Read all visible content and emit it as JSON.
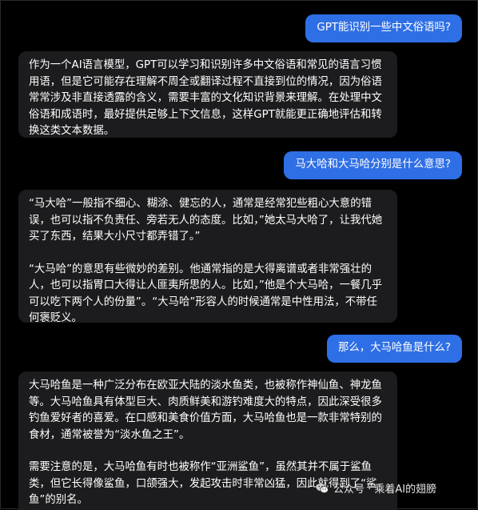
{
  "conversation": {
    "messages": [
      {
        "role": "user",
        "text": "GPT能识别一些中文俗语吗?"
      },
      {
        "role": "assistant",
        "paragraphs": [
          "作为一个AI语言模型，GPT可以学习和识别许多中文俗语和常见的语言习惯用语，但是它可能存在理解不周全或翻译过程不直接到位的情况，因为俗语常常涉及非直接透露的含义，需要丰富的文化知识背景来理解。在处理中文俗语和成语时，最好提供足够上下文信息，这样GPT就能更正确地评估和转换这类文本数据。"
        ]
      },
      {
        "role": "user",
        "text": "马大哈和大马哈分别是什么意思?"
      },
      {
        "role": "assistant",
        "paragraphs": [
          "“马大哈”一般指不细心、糊涂、健忘的人，通常是经常犯些粗心大意的错误，也可以指不负责任、旁若无人的态度。比如，”她太马大哈了，让我代她买了东西，结果大小尺寸都弄错了。”",
          "“大马哈”的意思有些微妙的差别。他通常指的是大得离谱或者非常强壮的人，也可以指胃口大得让人匪夷所思的人。比如，”他是个大马哈，一餐几乎可以吃下两个人的份量”。“大马哈”形容人的时候通常是中性用法，不带任何褒贬义。"
        ]
      },
      {
        "role": "user",
        "text": "那么，大马哈鱼是什么?"
      },
      {
        "role": "assistant",
        "paragraphs": [
          "大马哈鱼是一种广泛分布在欧亚大陆的淡水鱼类，也被称作神仙鱼、神龙鱼等。大马哈鱼具有体型巨大、肉质鲜美和游钓难度大的特点，因此深受很多钓鱼爱好者的喜爱。在口感和美食价值方面，大马哈鱼也是一款非常特别的食材，通常被誉为“淡水鱼之王”。",
          "需要注意的是，大马哈鱼有时也被称作“亚洲鲨鱼”，虽然其并不属于鲨鱼类，但它长得像鲨鱼，口颌强大，发起攻击时非常凶猛，因此就得到了“鲨鱼”的别名。"
        ]
      }
    ]
  },
  "watermark": {
    "icon": "wechat-icon",
    "text": "公众号 · 乘着AI的翅膀"
  },
  "colors": {
    "background": "#000000",
    "user_bubble": "#2f6fe5",
    "assistant_bubble": "#1c1c1e",
    "text": "#ffffff"
  }
}
